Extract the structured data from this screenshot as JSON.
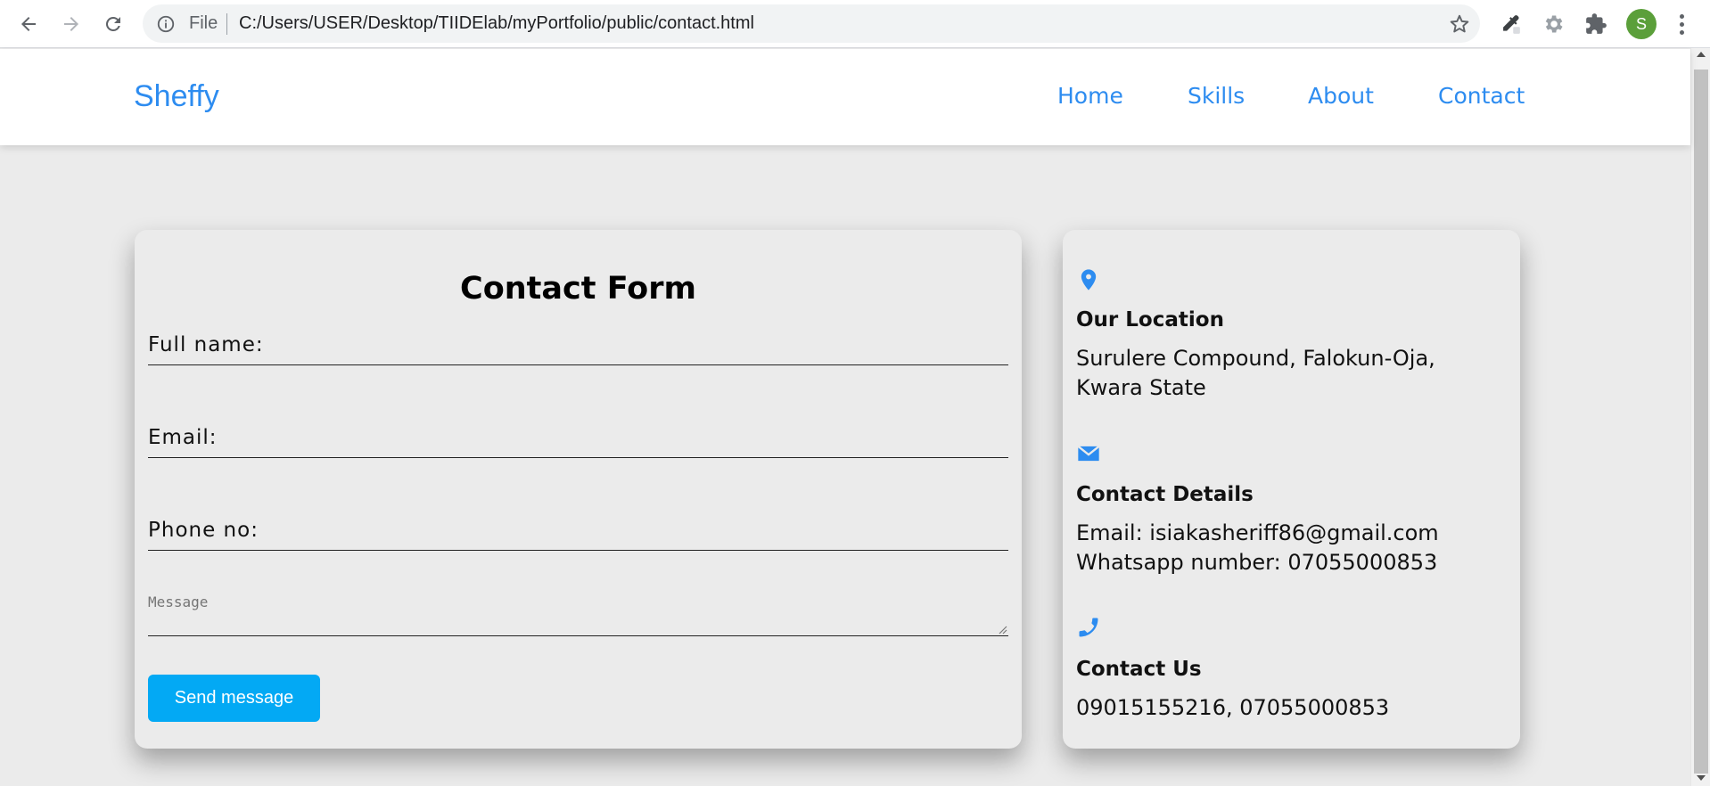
{
  "browser": {
    "omnibox_scheme": "File",
    "url": "C:/Users/USER/Desktop/TIIDElab/myPortfolio/public/contact.html",
    "profile_initial": "S",
    "icons": [
      "back-icon",
      "forward-icon",
      "reload-icon",
      "info-icon",
      "star-icon",
      "eyedropper-icon",
      "gear-icon",
      "puzzle-icon",
      "kebab-menu-icon"
    ]
  },
  "site": {
    "logo": "Sheffy",
    "nav": [
      {
        "label": "Home"
      },
      {
        "label": "Skills"
      },
      {
        "label": "About"
      },
      {
        "label": "Contact"
      }
    ],
    "accent_color": "#2d8cf0"
  },
  "form": {
    "title": "Contact Form",
    "full_name_label": "Full name:",
    "email_label": "Email:",
    "phone_label": "Phone no:",
    "message_placeholder": "Message",
    "send_label": "Send message",
    "button_color": "#03a9f4"
  },
  "info": {
    "location": {
      "icon": "map-pin-icon",
      "heading": "Our Location",
      "text": "Surulere Compound, Falokun-Oja, Kwara State"
    },
    "details": {
      "icon": "envelope-icon",
      "heading": "Contact Details",
      "email": "Email: isiakasheriff86@gmail.com",
      "whatsapp": "Whatsapp number: 07055000853"
    },
    "us": {
      "icon": "phone-icon",
      "heading": "Contact Us",
      "phones": "09015155216, 07055000853"
    }
  }
}
